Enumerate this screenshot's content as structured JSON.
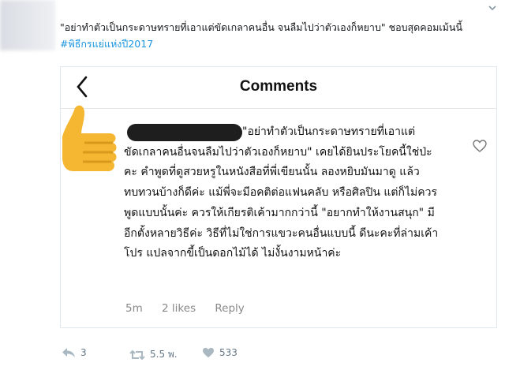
{
  "tweet": {
    "text": "\"อย่าทำตัวเป็นกระดาษทรายที่เอาแต่ขัดเกลาคนอื่น จนลืมไปว่าตัวเองก็หยาบ\" ชอบสุดคอมเม้นนี้ ",
    "hashtag": "#พิธีกรแย่แห่งปี2017"
  },
  "card": {
    "title": "Comments",
    "comment": "\"อย่าทำตัวเป็นกระดาษทรายที่เอาแต่ขัดเกลาคนอื่นจนลืมไปว่าตัวเองก็หยาบ\" เคยได้ยินประโยคนี้ใช่ป่ะคะ คำพูดที่ดูสวยหรูในหนังสือที่พี่เขียนนั้น ลองหยิบมันมาดู แล้วทบทวนบ้างก็ดีค่ะ แม้พี่จะมีอคติต่อแฟนคลับ หรือศิลปิน แต่ก็ไม่ควรพูดแบบนั้นค่ะ ควรให้เกียรติเค้ามากกว่านี้ \"อยากทำให้งานสนุก\" มีอีกตั้งหลายวิธีค่ะ วิธีที่ไม่ใช่การแขวะคนอื่นแบบนี้ ดีนะคะที่ล่ามเค้าโปร แปลจากขี้เป็นดอกไม้ได้ ไม่งั้นงามหน้าค่ะ",
    "time": "5m",
    "likes": "2 likes",
    "reply": "Reply"
  },
  "actions": {
    "reply_count": "3",
    "retweet_count": "5.5 พ.",
    "like_count": "533"
  },
  "colors": {
    "hashtag": "#1b95e0",
    "action_icon": "#aab8c2",
    "like_icon": "#aab8c2",
    "thumb": "#f5b731"
  },
  "icons": [
    "chevron-down-icon",
    "back-arrow-icon",
    "thumbs-up-icon",
    "heart-outline-icon",
    "reply-icon",
    "retweet-icon",
    "like-icon"
  ]
}
